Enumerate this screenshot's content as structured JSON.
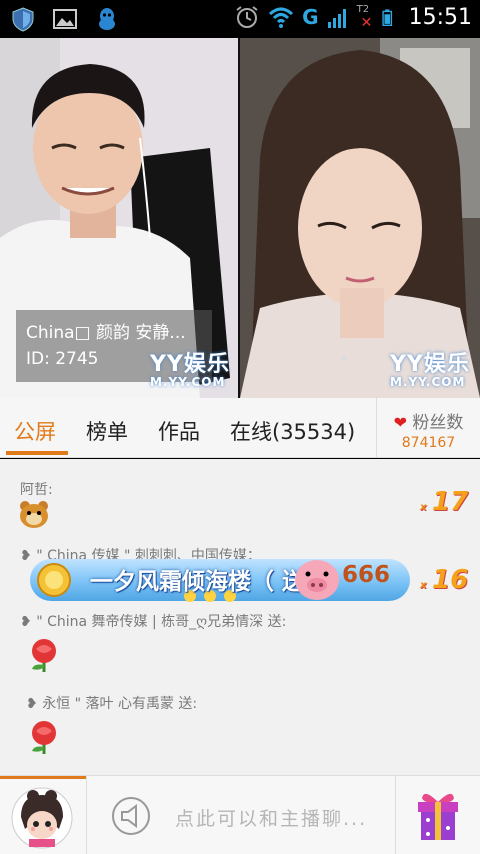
{
  "status_bar": {
    "time": "15:51",
    "network": "G",
    "sim2": "T2"
  },
  "videos": {
    "left": {
      "name": "Сhinа□ 颜韵 安静...",
      "id": "ID: 2745",
      "watermark_brand": "YY娱乐",
      "watermark_url": "M.YY.COM"
    },
    "right": {
      "watermark_brand": "YY娱乐",
      "watermark_url": "M.YY.COM"
    }
  },
  "tabs": [
    {
      "label": "公屏",
      "active": true
    },
    {
      "label": "榜单",
      "active": false
    },
    {
      "label": "作品",
      "active": false
    },
    {
      "label": "在线(35534)",
      "active": false
    }
  ],
  "fans": {
    "label": "粉丝数",
    "count": "874167"
  },
  "chat": {
    "messages": [
      {
        "user": "阿哲:",
        "gift": "bear-face",
        "combo_mark": "x",
        "combo_count": "17"
      },
      {
        "user": "\" Сhinа 传媒 \" 刺刺刺、中国传媒：",
        "combo_mark": "x",
        "combo_count": "16"
      },
      {
        "user": "\" Сhinа 舞帝传媒 | 栋哥_ღ兄弟情深 送:",
        "gift": "rose"
      },
      {
        "user": "永恒 \" 落叶 心有禹蒙 送:",
        "gift": "rose"
      }
    ],
    "banner": {
      "text": "一夕风霜倾海楼（ 送",
      "count": "666"
    }
  },
  "bottom": {
    "placeholder": "点此可以和主播聊..."
  }
}
